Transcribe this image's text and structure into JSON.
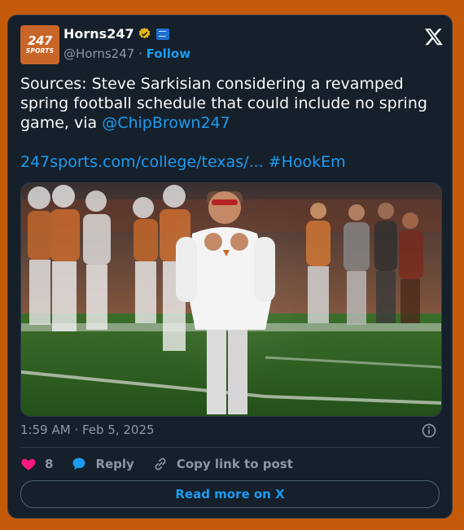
{
  "account": {
    "avatar_top": "247",
    "avatar_bottom": "SPORTS",
    "name": "Horns247",
    "handle": "@Horns247",
    "separator": "·",
    "follow_label": "Follow"
  },
  "tweet": {
    "text": "Sources: Steve Sarkisian considering a revamped spring football schedule that could include no spring game, via ",
    "mention": "@ChipBrown247",
    "link": "247sports.com/college/texas/...",
    "hashtag": "#HookEm",
    "timestamp": "1:59 AM · Feb 5, 2025"
  },
  "actions": {
    "likes": "8",
    "reply_label": "Reply",
    "copy_label": "Copy link to post",
    "read_more_label": "Read more on X"
  },
  "colors": {
    "page_background": "#c55a0a",
    "card_background": "#15202b",
    "accent_blue": "#1d9bf0",
    "like_pink": "#f91880",
    "verified_gold": "#e2b719",
    "muted_text": "#8b98a5"
  },
  "icons": {
    "verified": "verified-badge-icon",
    "affiliate": "affiliate-badge-icon",
    "logo": "x-logo-icon",
    "info": "info-icon",
    "like": "heart-icon",
    "reply": "speech-bubble-icon",
    "copy": "link-icon"
  }
}
